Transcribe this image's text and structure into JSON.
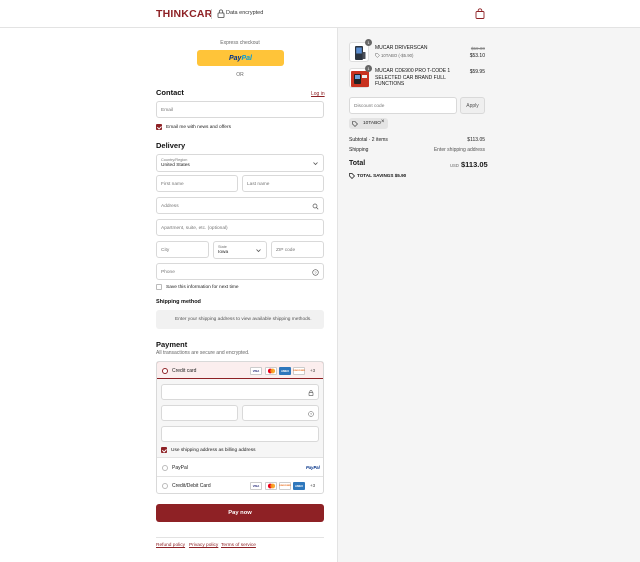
{
  "header": {
    "brand": "THINKCAR",
    "security_text": "Data encrypted",
    "icons": [
      "lock-icon",
      "shopping-bag-icon"
    ]
  },
  "express": {
    "label": "Express checkout",
    "paypal_text_a": "Pay",
    "paypal_text_b": "Pal",
    "or_text": "OR"
  },
  "contact": {
    "heading": "Contact",
    "login_link": "Log in",
    "email_placeholder": "Email",
    "news_checkbox_label": "Email me with news and offers",
    "news_checked": true
  },
  "delivery": {
    "heading": "Delivery",
    "country_label": "Country/Region",
    "country_value": "United States",
    "first_name_placeholder": "First name",
    "last_name_placeholder": "Last name",
    "address_placeholder": "Address",
    "apartment_placeholder": "Apartment, suite, etc. (optional)",
    "city_placeholder": "City",
    "state_label": "State",
    "state_value": "Iowa",
    "zip_placeholder": "ZIP code",
    "phone_placeholder": "Phone",
    "save_info_label": "Save this information for next time",
    "save_info_checked": false
  },
  "shipping": {
    "heading": "Shipping method",
    "note": "Enter your shipping address to view available shipping methods."
  },
  "payment": {
    "heading": "Payment",
    "subtitle": "All transactions are secure and encrypted.",
    "credit_card_label": "Credit card",
    "credit_card_more": "+3",
    "card_logos": [
      "VISA",
      "MC",
      "AMEX",
      "DISCOVER"
    ],
    "billing_checkbox_label": "Use shipping address as billing address",
    "billing_checked": true,
    "paypal_label": "PayPal",
    "paypal_logo": "PayPal",
    "debit_label": "Credit/Debit Card",
    "debit_more": "+3",
    "pay_button": "Pay now"
  },
  "footer": {
    "links": [
      "Refund policy",
      "Privacy policy",
      "Terms of service"
    ]
  },
  "cart": {
    "items": [
      {
        "name": "MUCAR DRIVERSCAN",
        "meta": "10TABO (-$5.90)",
        "quantity": "1",
        "old_price": "$59.00",
        "price": "$53.10"
      },
      {
        "name": "MUCAR CDE900 PRO T-CODE 1 SELECTED CAR BRAND FULL FUNCTIONS",
        "quantity": "1",
        "price": "$59.95"
      }
    ],
    "discount_placeholder": "Discount code",
    "apply_label": "Apply",
    "applied_code": "10TABO",
    "subtotal_label": "Subtotal · 2 items",
    "subtotal_value": "$113.05",
    "shipping_label": "Shipping",
    "shipping_value": "Enter shipping address",
    "total_label": "Total",
    "currency": "USD",
    "total_value": "$113.05",
    "savings_text": "TOTAL SAVINGS  $5.90"
  },
  "colors": {
    "brand": "#8e2125",
    "paypal_yellow": "#ffc439",
    "panel_bg": "#f5f5f5"
  }
}
